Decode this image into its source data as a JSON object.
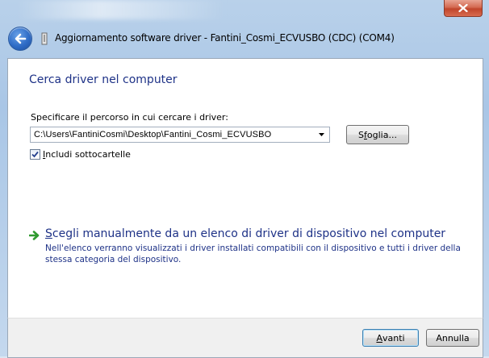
{
  "window": {
    "close_glyph": "✕",
    "title_prefix": "Aggiornamento software driver - ",
    "device_name": "Fantini_Cosmi_ECVUSBO (CDC) (COM4)"
  },
  "page": {
    "heading": "Cerca driver nel computer",
    "path_label": "Specificare il percorso in cui cercare i driver:",
    "path_value_prefix": "C:\\Users\\",
    "path_value_user": "FantiniCosmi",
    "path_value_rest": "\\Desktop\\Fantini_Cosmi_ECVUSBO",
    "browse": {
      "label_pre": "S",
      "label_accel": "f",
      "label_post": "oglia..."
    },
    "include_subfolders": {
      "checked": true,
      "label_accel": "I",
      "label_rest": "ncludi sottocartelle"
    },
    "manual": {
      "title_accel": "S",
      "title_rest": "cegli manualmente da un elenco di driver di dispositivo nel computer",
      "description": "Nell'elenco verranno visualizzati i driver installati compatibili con il dispositivo e tutti i driver della stessa categoria del dispositivo."
    }
  },
  "footer": {
    "next": {
      "accel": "A",
      "rest": "vanti"
    },
    "cancel": "Annulla"
  },
  "colors": {
    "link": "#1e3287",
    "heading": "#1e3287",
    "close": "#c0452b"
  }
}
